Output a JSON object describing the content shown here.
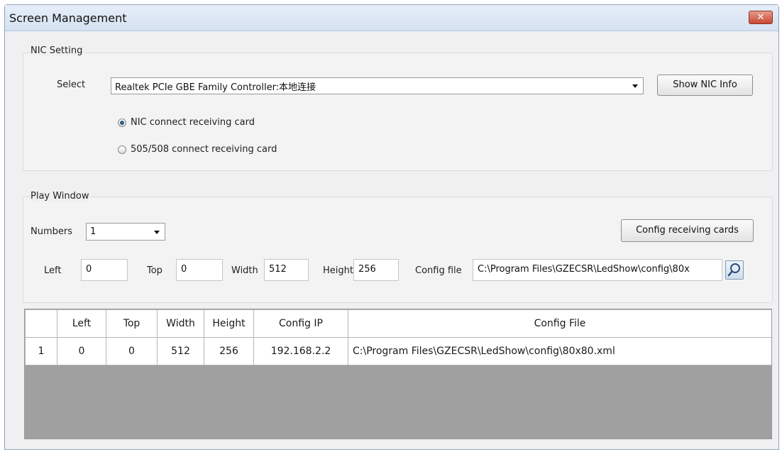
{
  "window": {
    "title": "Screen Management",
    "close_glyph": "✕"
  },
  "nic_setting": {
    "label": "NIC Setting",
    "select_label": "Select",
    "selected_nic": "Realtek PCIe GBE Family Controller:本地连接",
    "show_info_button": "Show NIC Info",
    "radio_options": [
      {
        "label": "NIC connect receiving card",
        "checked": true
      },
      {
        "label": "505/508 connect receiving card",
        "checked": false
      }
    ]
  },
  "play_window": {
    "label": "Play Window",
    "numbers_label": "Numbers",
    "numbers_value": "1",
    "config_cards_button": "Config receiving cards",
    "fields": {
      "left_label": "Left",
      "left_value": "0",
      "top_label": "Top",
      "top_value": "0",
      "width_label": "Width",
      "width_value": "512",
      "height_label": "Height",
      "height_value": "256",
      "config_file_label": "Config file",
      "config_file_value": "C:\\Program Files\\GZECSR\\LedShow\\config\\80x"
    },
    "search_icon": "search-icon"
  },
  "grid": {
    "columns": [
      "",
      "Left",
      "Top",
      "Width",
      "Height",
      "Config IP",
      "Config File"
    ],
    "rows": [
      [
        "1",
        "0",
        "0",
        "512",
        "256",
        "192.168.2.2",
        "C:\\Program Files\\GZECSR\\LedShow\\config\\80x80.xml"
      ]
    ]
  },
  "colors": {
    "title_bar": "#dce7f4",
    "close_button": "#c74a35",
    "grid_empty_area": "#a0a0a0"
  }
}
